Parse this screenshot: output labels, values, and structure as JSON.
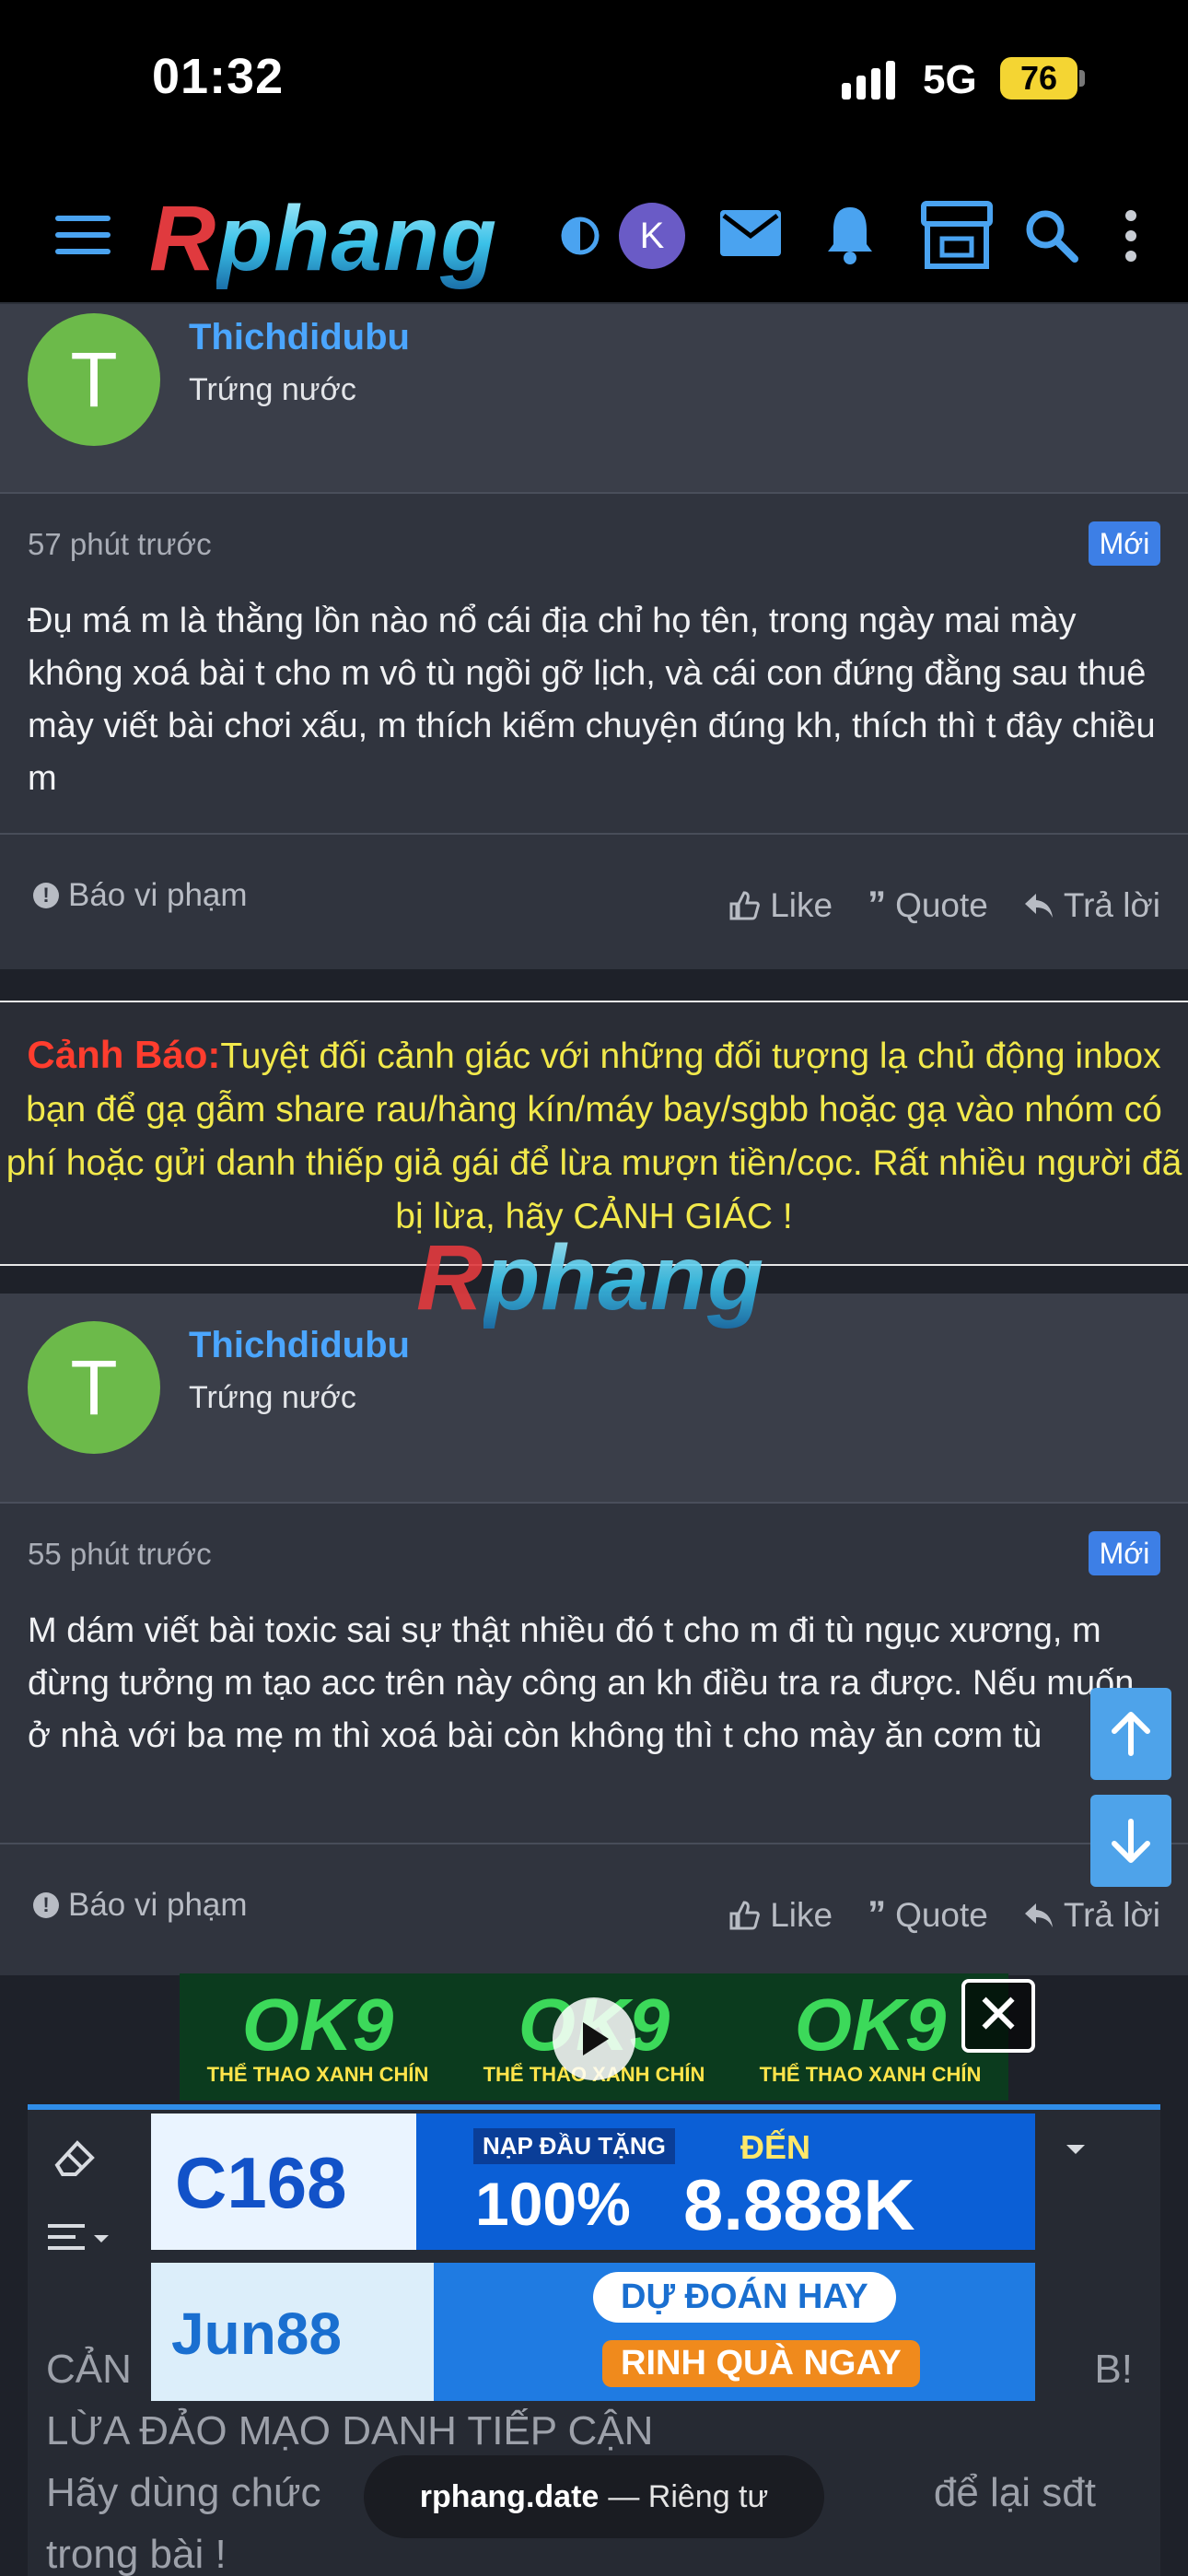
{
  "status_bar": {
    "time": "01:32",
    "network": "5G",
    "battery": "76"
  },
  "nav": {
    "logo_part1": "R",
    "logo_part2": "phang",
    "avatar_letter": "K"
  },
  "posts": [
    {
      "avatar_letter": "T",
      "username": "Thichdidubu",
      "user_title": "Trứng nước",
      "time": "57 phút trước",
      "badge": "Mới",
      "body": "Đụ má m là thằng lồn nào nổ cái địa chỉ họ tên, trong ngày mai mày không xoá bài t cho m vô tù ngồi gỡ lịch, và cái con đứng đằng sau thuê mày viết bài chơi xấu, m thích kiếm chuyện đúng kh, thích thì t đây chiều m",
      "report": "Báo vi phạm",
      "like": "Like",
      "quote": "Quote",
      "reply": "Trả lời"
    },
    {
      "avatar_letter": "T",
      "username": "Thichdidubu",
      "user_title": "Trứng nước",
      "time": "55 phút trước",
      "badge": "Mới",
      "body": "M dám viết bài toxic sai sự thật nhiều đó t cho m đi tù ngục xương, m đừng tưởng m tạo acc trên này công an kh điều tra ra được. Nếu muốn ở nhà với ba mẹ m thì xoá bài còn không thì t cho mày ăn cơm tù",
      "report": "Báo vi phạm",
      "like": "Like",
      "quote": "Quote",
      "reply": "Trả lời"
    }
  ],
  "warning": {
    "label": "Cảnh Báo:",
    "text": "Tuyệt đối cảnh giác với những đối tượng lạ chủ động inbox bạn để gạ gẫm share rau/hàng kín/máy bay/sgbb hoặc gạ vào nhóm có phí hoặc gửi danh thiếp giả gái để lừa mượn tiền/cọc. Rất nhiều người đã bị lừa, hãy CẢNH GIÁC !"
  },
  "watermark": {
    "part1": "R",
    "part2": "phang"
  },
  "editor": {
    "line1": "CẢN",
    "line1_end": "B!",
    "line2": "LỪA ĐẢO MẠO DANH TIẾP CẬN",
    "line3": "Hãy dùng chức",
    "line3_end": "để lại sđt",
    "line4": "trong bài !"
  },
  "ads": {
    "ok9": {
      "logo": "OK9",
      "tagline": "THỂ THAO XANH CHÍN"
    },
    "c168": {
      "brand": "C168",
      "promo_label": "NẠP ĐẦU TẶNG",
      "promo_value": "100%",
      "to_label": "ĐẾN",
      "amount": "8.888K"
    },
    "jun88": {
      "brand": "Jun88",
      "headline": "DỰ ĐOÁN HAY",
      "cta": "RINH QUÀ NGAY"
    }
  },
  "browser": {
    "domain": "rphang.date",
    "mode": "Riêng tư"
  },
  "colors": {
    "accent": "#4ba6ff",
    "warning_label": "#ff3d2e",
    "warning_text": "#f2e94b",
    "badge": "#3d7fe6",
    "avatar": "#6cba4a"
  }
}
